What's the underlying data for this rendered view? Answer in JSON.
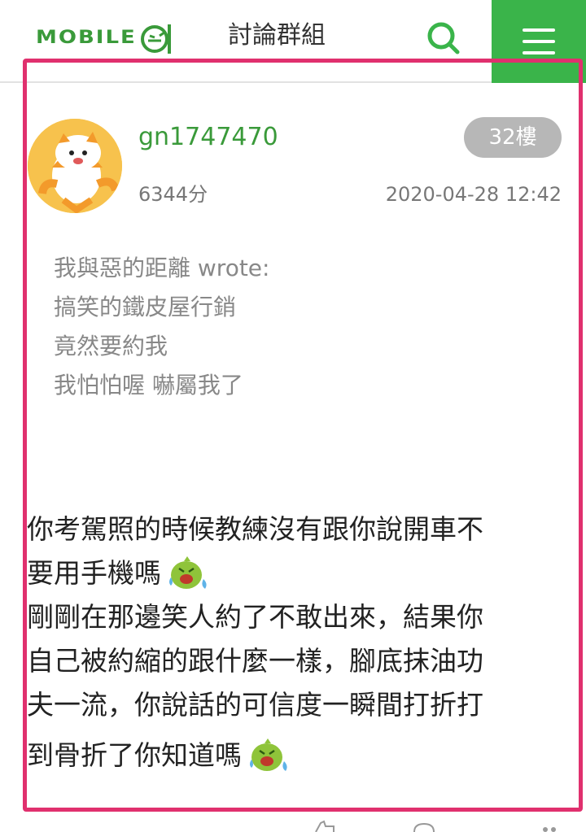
{
  "header": {
    "logo_text": "MOBILE",
    "title": "討論群組",
    "search_icon": "search-icon",
    "menu_icon": "menu-icon",
    "accent_color": "#3ab44a"
  },
  "post": {
    "username": "gn1747470",
    "floor": "32樓",
    "score": "6344分",
    "timestamp": "2020-04-28 12:42",
    "highlight_color": "#e0306e",
    "quote": {
      "lines": [
        "我與惡的距離 wrote:",
        "搞笑的鐵皮屋行銷",
        "竟然要約我",
        "我怕怕喔 嚇屬我了"
      ]
    },
    "body_lines": [
      "你考駕照的時候教練沒有跟你說開車不",
      "要用手機嗎",
      "剛剛在那邊笑人約了不敢出來，結果你",
      "自己被約縮的跟什麼一樣，腳底抹油功",
      "夫一流，你說話的可信度一瞬間打折打",
      "到骨折了你知道嗎"
    ],
    "emoji_icon": "laughing-crying-emoji"
  }
}
